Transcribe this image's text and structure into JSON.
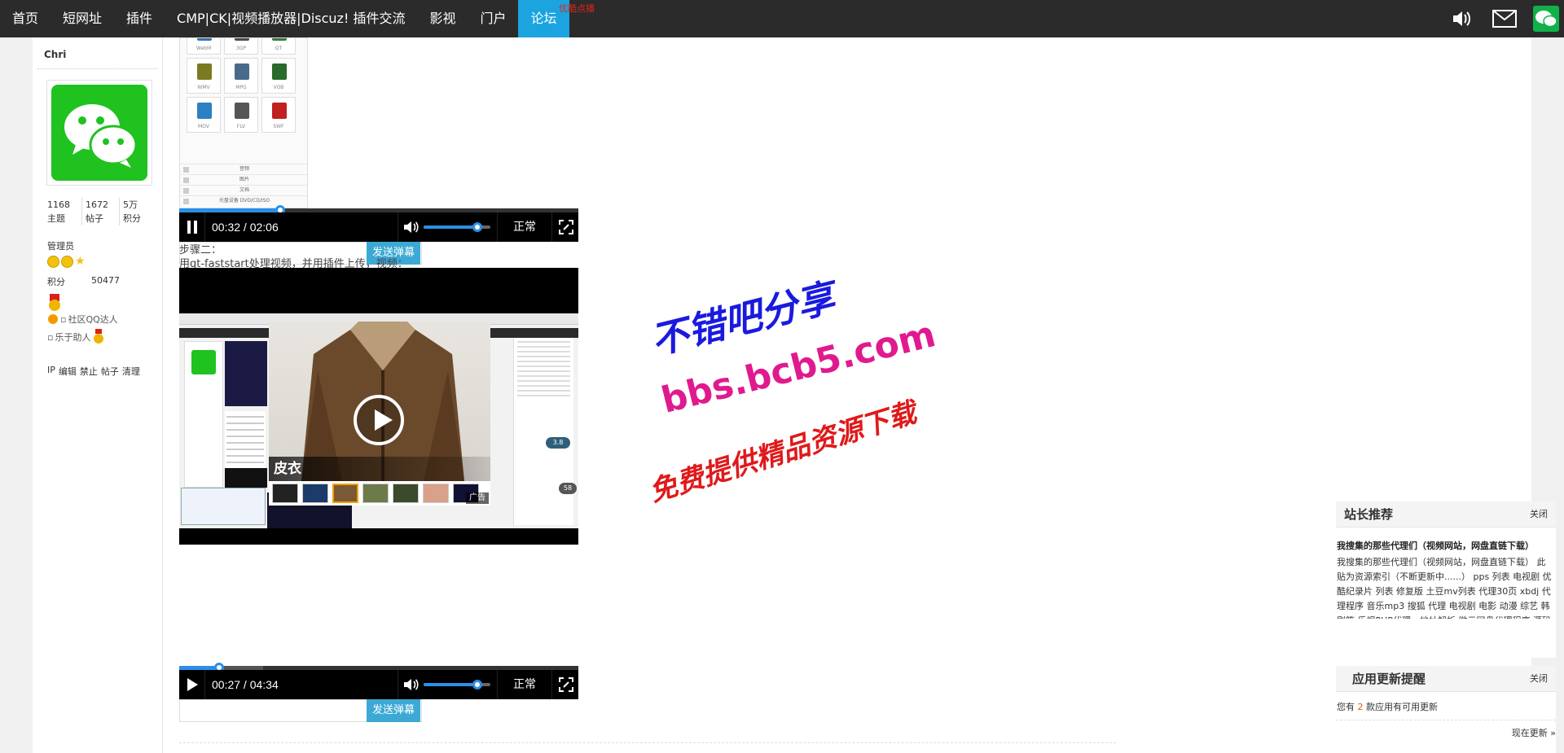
{
  "nav": {
    "items": [
      "首页",
      "短网址",
      "插件",
      "CMP|CK|视频播放器|Discuz! 插件交流",
      "影视",
      "门户",
      "论坛"
    ],
    "active_index": 6,
    "badge": "优酷点播"
  },
  "author": {
    "name": "Chri",
    "stats": [
      {
        "value": "1168",
        "label": "主题"
      },
      {
        "value": "1672",
        "label": "帖子"
      },
      {
        "value": "5万",
        "label": "积分"
      }
    ],
    "role": "管理员",
    "credit_label": "积分",
    "credit_value": "50477",
    "medal_qq": "社区QQ达人",
    "medal_helper": "乐于助人",
    "actions": [
      "IP",
      "编辑",
      "禁止",
      "帖子",
      "清理"
    ]
  },
  "screenshot_top": {
    "files": [
      "WebM",
      "3GP",
      "QT",
      "WMV",
      "MPG",
      "VOB",
      "MOV",
      "FLV",
      "SWF"
    ],
    "list": [
      "音频",
      "图片",
      "文档",
      "光盘设备 DVD/CD/ISO"
    ]
  },
  "player1": {
    "time": "00:32 / 02:06",
    "speed": "正常",
    "progress": 0.254,
    "volume": 0.8
  },
  "danmu_button": "发送弹幕",
  "step": {
    "title": "步骤二：",
    "desc": "用qt-faststart处理视频，并用插件上传，视频："
  },
  "ad": {
    "title": "皮衣",
    "label": "广告"
  },
  "inner_badges": [
    "3.8",
    "58"
  ],
  "player2": {
    "time": "00:27 / 04:34",
    "speed": "正常",
    "progress": 0.099,
    "buffered": 0.21,
    "volume": 0.8
  },
  "watermark": {
    "line1": "不错吧分享",
    "line2": "bbs.bcb5.com",
    "line3": "免费提供精品资源下载"
  },
  "recommend": {
    "title": "站长推荐",
    "close": "关闭",
    "headline": "我搜集的那些代理们（视频网站，网盘直链下载）",
    "body": "我搜集的那些代理们（视频网站，网盘直链下载） 此贴为资源索引（不断更新中......） pps 列表 电视剧 优酷纪录片 列表 修复版 土豆mv列表 代理30页 xbdj 代理程序 音乐mp3 搜狐 代理 电视剧 电影 动漫 综艺 韩剧等 乐视PHP代理，地址解析 微云网盘代理程序 源码 直连下载 优酷全站视频代理程序 百度网盘新解析（代理） 修改版 支持bae 去掉无用代码"
  },
  "update": {
    "title": "应用更新提醒",
    "close": "关闭",
    "text_prefix": "您有",
    "count": "2",
    "text_suffix": "款应用有可用更新",
    "now": "现在更新 »"
  },
  "colors": {
    "nav_bg": "#2b2b2b",
    "nav_active": "#1ba4e0",
    "player_accent": "#2b8fe8",
    "danmu_btn": "#3ba9d4"
  }
}
